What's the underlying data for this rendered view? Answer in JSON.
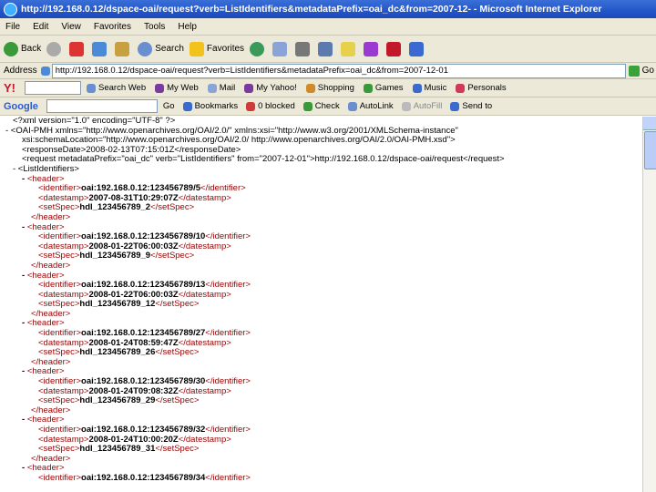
{
  "window": {
    "title": "http://192.168.0.12/dspace-oai/request?verb=ListIdentifiers&metadataPrefix=oai_dc&from=2007-12- - Microsoft Internet Explorer"
  },
  "menu": [
    "File",
    "Edit",
    "View",
    "Favorites",
    "Tools",
    "Help"
  ],
  "toolbar": {
    "back": "Back",
    "search": "Search",
    "favorites": "Favorites"
  },
  "address": {
    "label": "Address",
    "url": "http://192.168.0.12/dspace-oai/request?verb=ListIdentifiers&metadataPrefix=oai_dc&from=2007-12-01",
    "go": "Go"
  },
  "yahoo_bar": {
    "logo": "Y!",
    "search_web": "Search Web",
    "my_web": "My Web",
    "mail": "Mail",
    "my_yahoo": "My Yahoo!",
    "shopping": "Shopping",
    "games": "Games",
    "music": "Music",
    "personals": "Personals"
  },
  "google_bar": {
    "logo": "Google",
    "go": "Go",
    "bookmarks": "Bookmarks",
    "popups": "0 blocked",
    "check": "Check",
    "autolink": "AutoLink",
    "autofill": "AutoFill",
    "send_to": "Send to"
  },
  "xml": {
    "decl": "<?xml version=\"1.0\" encoding=\"UTF-8\" ?>",
    "root_open": "- <OAI-PMH xmlns=\"http://www.openarchives.org/OAI/2.0/\" xmlns:xsi=\"http://www.w3.org/2001/XMLSchema-instance\"",
    "schema_loc": "xsi:schemaLocation=\"http://www.openarchives.org/OAI/2.0/ http://www.openarchives.org/OAI/2.0/OAI-PMH.xsd\">",
    "response_date": "<responseDate>2008-02-13T07:15:01Z</responseDate>",
    "request": "<request metadataPrefix=\"oai_dc\" verb=\"ListIdentifiers\" from=\"2007-12-01\">http://192.168.0.12/dspace-oai/request</request>",
    "list_open": "- <ListIdentifiers>",
    "headers": [
      {
        "identifier": "oai:192.168.0.12:123456789/5",
        "datestamp": "2007-08-31T10:29:07Z",
        "setSpec": "hdl_123456789_2"
      },
      {
        "identifier": "oai:192.168.0.12:123456789/10",
        "datestamp": "2008-01-22T06:00:03Z",
        "setSpec": "hdl_123456789_9"
      },
      {
        "identifier": "oai:192.168.0.12:123456789/13",
        "datestamp": "2008-01-22T06:00:03Z",
        "setSpec": "hdl_123456789_12"
      },
      {
        "identifier": "oai:192.168.0.12:123456789/27",
        "datestamp": "2008-01-24T08:59:47Z",
        "setSpec": "hdl_123456789_26"
      },
      {
        "identifier": "oai:192.168.0.12:123456789/30",
        "datestamp": "2008-01-24T09:08:32Z",
        "setSpec": "hdl_123456789_29"
      },
      {
        "identifier": "oai:192.168.0.12:123456789/32",
        "datestamp": "2008-01-24T10:00:20Z",
        "setSpec": "hdl_123456789_31"
      },
      {
        "identifier": "oai:192.168.0.12:123456789/34",
        "datestamp": "",
        "setSpec": ""
      }
    ]
  }
}
